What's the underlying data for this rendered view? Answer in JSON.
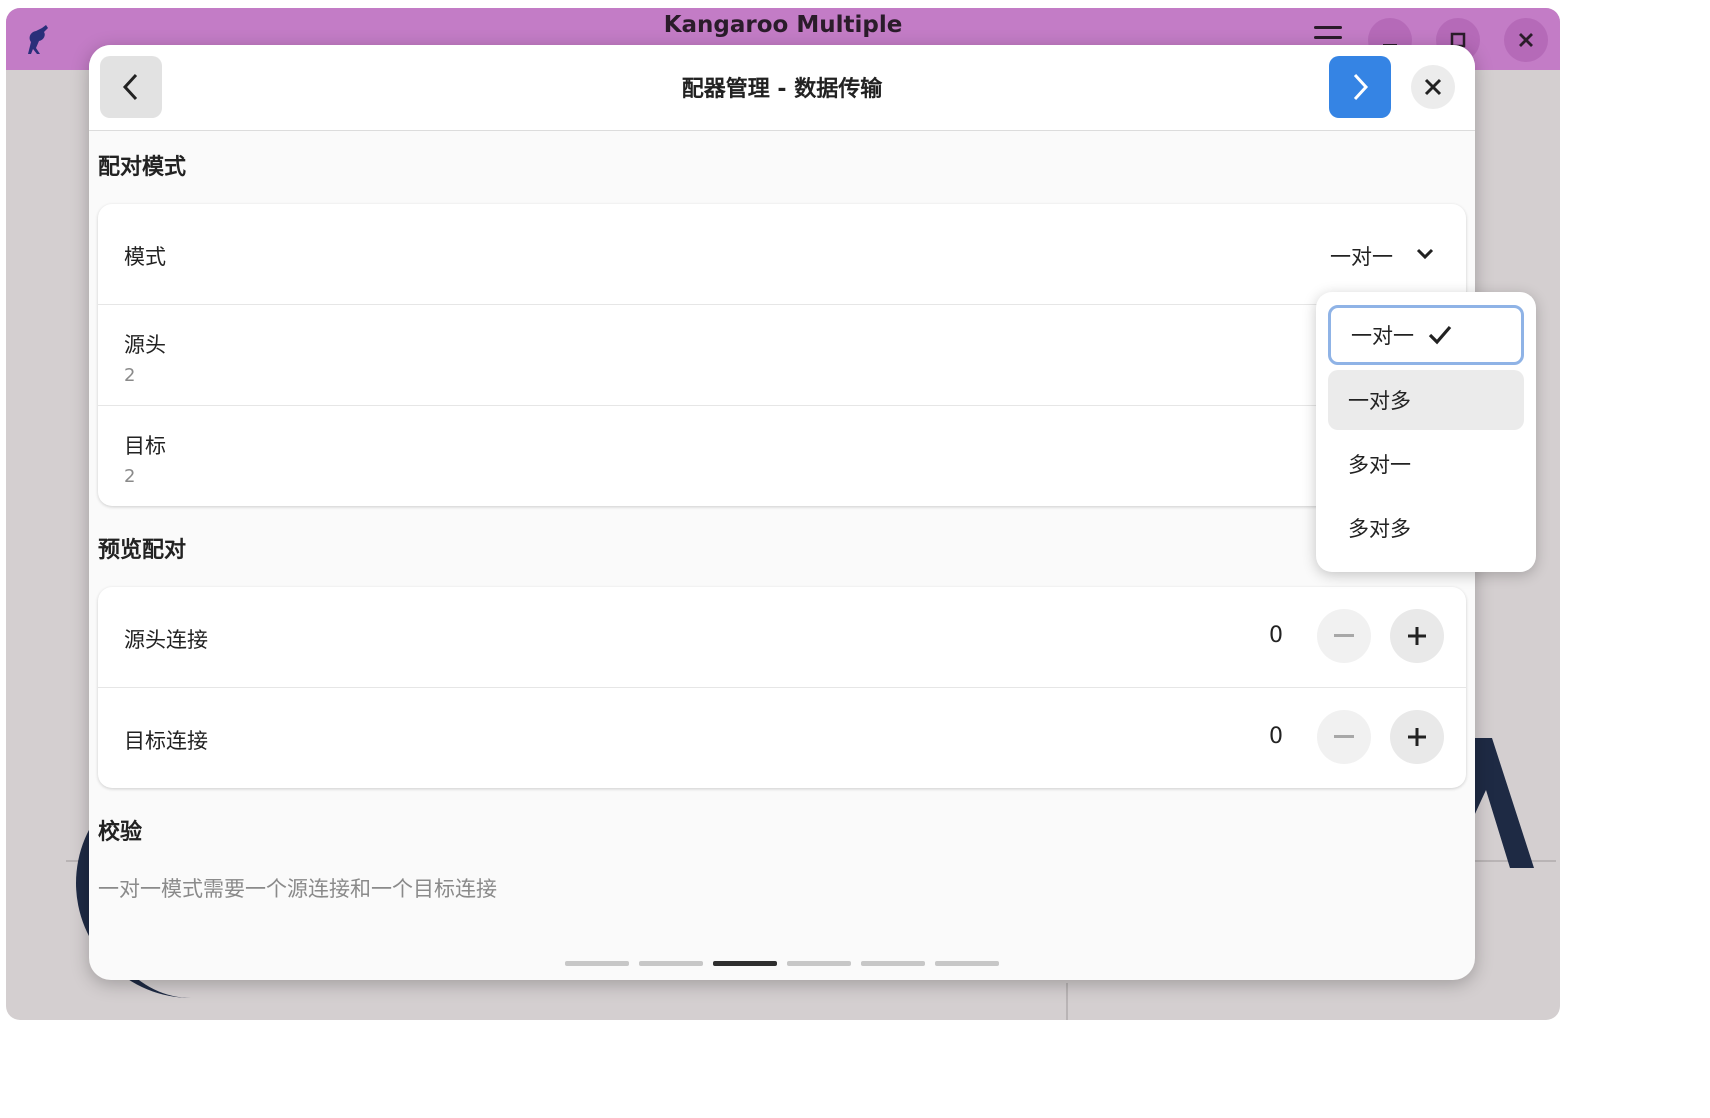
{
  "window": {
    "title": "Kangaroo Multiple",
    "titlebar_color": "#c37cc6"
  },
  "dialog": {
    "title": "配器管理 - 数据传输",
    "back_icon": "chevron-left-icon",
    "next_icon": "chevron-right-icon",
    "close_icon": "close-icon",
    "accent": "#3584e4"
  },
  "pairing_mode": {
    "section_title": "配对模式",
    "mode_label": "模式",
    "mode_value": "一对一",
    "source_label": "源头",
    "source_value": "2",
    "target_label": "目标",
    "target_value": "2"
  },
  "preview": {
    "section_title": "预览配对",
    "source_conn_label": "源头连接",
    "source_conn_value": "0",
    "target_conn_label": "目标连接",
    "target_conn_value": "0"
  },
  "validation": {
    "section_title": "校验",
    "message": "一对一模式需要一个源连接和一个目标连接"
  },
  "mode_options": {
    "opt1": "一对一",
    "opt2": "一对多",
    "opt3": "多对一",
    "opt4": "多对多",
    "selected": "一对一"
  },
  "pager": {
    "pages": 6,
    "current": 3
  }
}
